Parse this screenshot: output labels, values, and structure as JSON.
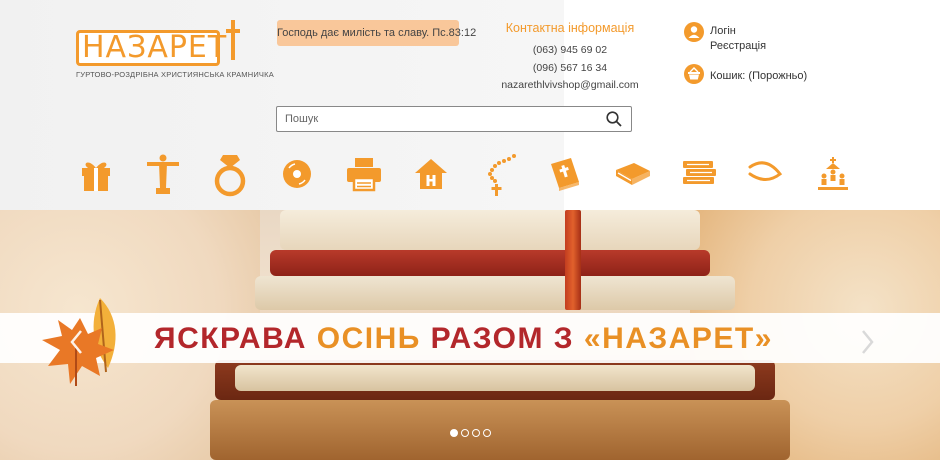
{
  "logo": {
    "name": "НАЗАРЕТ",
    "tagline": "ГУРТОВО-РОЗДРІБНА ХРИСТИЯНСЬКА КРАМНИЧКА"
  },
  "quote": "Господь дає милість та славу. Пс.83:12",
  "contacts": {
    "title": "Контактна інформація",
    "phone1": "(063) 945 69 02",
    "phone2": "(096) 567 16 34",
    "email": "nazarethlvivshop@gmail.com"
  },
  "account": {
    "login": "Логін",
    "register": "Реєстрація",
    "cart": "Кошик: (Порожньо)"
  },
  "search": {
    "placeholder": "Пошук"
  },
  "categories": [
    {
      "icon": "gift-icon"
    },
    {
      "icon": "christ-statue-icon"
    },
    {
      "icon": "ring-icon"
    },
    {
      "icon": "disc-icon"
    },
    {
      "icon": "printer-icon"
    },
    {
      "icon": "home-icon"
    },
    {
      "icon": "rosary-icon"
    },
    {
      "icon": "bible-icon"
    },
    {
      "icon": "book-icon"
    },
    {
      "icon": "books-stack-icon"
    },
    {
      "icon": "fish-icon"
    },
    {
      "icon": "church-community-icon"
    }
  ],
  "banner": {
    "slogan_part1": "ЯСКРАВА",
    "slogan_part2": "ОСІНЬ",
    "slogan_part3": "РАЗОМ З",
    "slogan_part4": "«НАЗАРЕТ»",
    "slides_total": 4,
    "active_slide": 1
  },
  "colors": {
    "accent": "#f39a2c",
    "slogan_red": "#b3272b",
    "slogan_orange": "#e99025",
    "quote_bg": "#f9c79a"
  }
}
